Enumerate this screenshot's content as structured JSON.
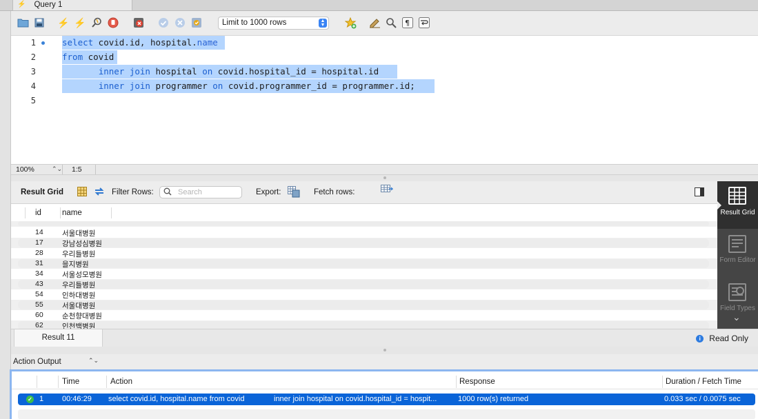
{
  "tab": {
    "title": "Query 1"
  },
  "toolbar": {
    "limit_label": "Limit to 1000 rows",
    "icons": [
      "open-folder-icon",
      "save-icon",
      "execute-icon",
      "execute-current-icon",
      "explain-icon",
      "stop-icon",
      "toggle-error-icon",
      "commit-icon",
      "rollback-icon",
      "autocommit-icon",
      "beautify-icon",
      "snippet-icon",
      "find-icon",
      "invisible-chars-icon",
      "wrap-icon"
    ]
  },
  "editor": {
    "line_numbers": [
      "1",
      "2",
      "3",
      "4",
      "5"
    ],
    "zoom": "100%",
    "cursor_pos": "1:5"
  },
  "result_toolbar": {
    "title": "Result Grid",
    "filter_label": "Filter Rows:",
    "search_placeholder": "Search",
    "export_label": "Export:",
    "fetch_label": "Fetch rows:"
  },
  "grid": {
    "columns": [
      "id",
      "name"
    ],
    "rows": [
      {
        "id": "14",
        "name": "서울대병원"
      },
      {
        "id": "17",
        "name": "강남성심병원"
      },
      {
        "id": "28",
        "name": "우리들병원"
      },
      {
        "id": "31",
        "name": "을지병원"
      },
      {
        "id": "34",
        "name": "서울성모병원"
      },
      {
        "id": "43",
        "name": "우리들병원"
      },
      {
        "id": "54",
        "name": "인하대병원"
      },
      {
        "id": "55",
        "name": "서울대병원"
      },
      {
        "id": "60",
        "name": "순천향대병원"
      },
      {
        "id": "62",
        "name": "인천백병원"
      }
    ]
  },
  "side_panel": {
    "result_grid": "Result Grid",
    "form_editor": "Form Editor",
    "field_types": "Field Types"
  },
  "result_tabs": {
    "tab_label": "Result 11",
    "read_only": "Read Only"
  },
  "action_output": {
    "title": "Action Output",
    "headers": [
      "Time",
      "Action",
      "Response",
      "Duration / Fetch Time"
    ],
    "row": {
      "num": "1",
      "time": "00:46:29",
      "action": "select covid.id, hospital.name from covid",
      "action_cont": "inner join hospital on covid.hospital_id = hospit...",
      "response": "1000 row(s) returned",
      "duration": "0.033 sec / 0.0075 sec"
    }
  }
}
